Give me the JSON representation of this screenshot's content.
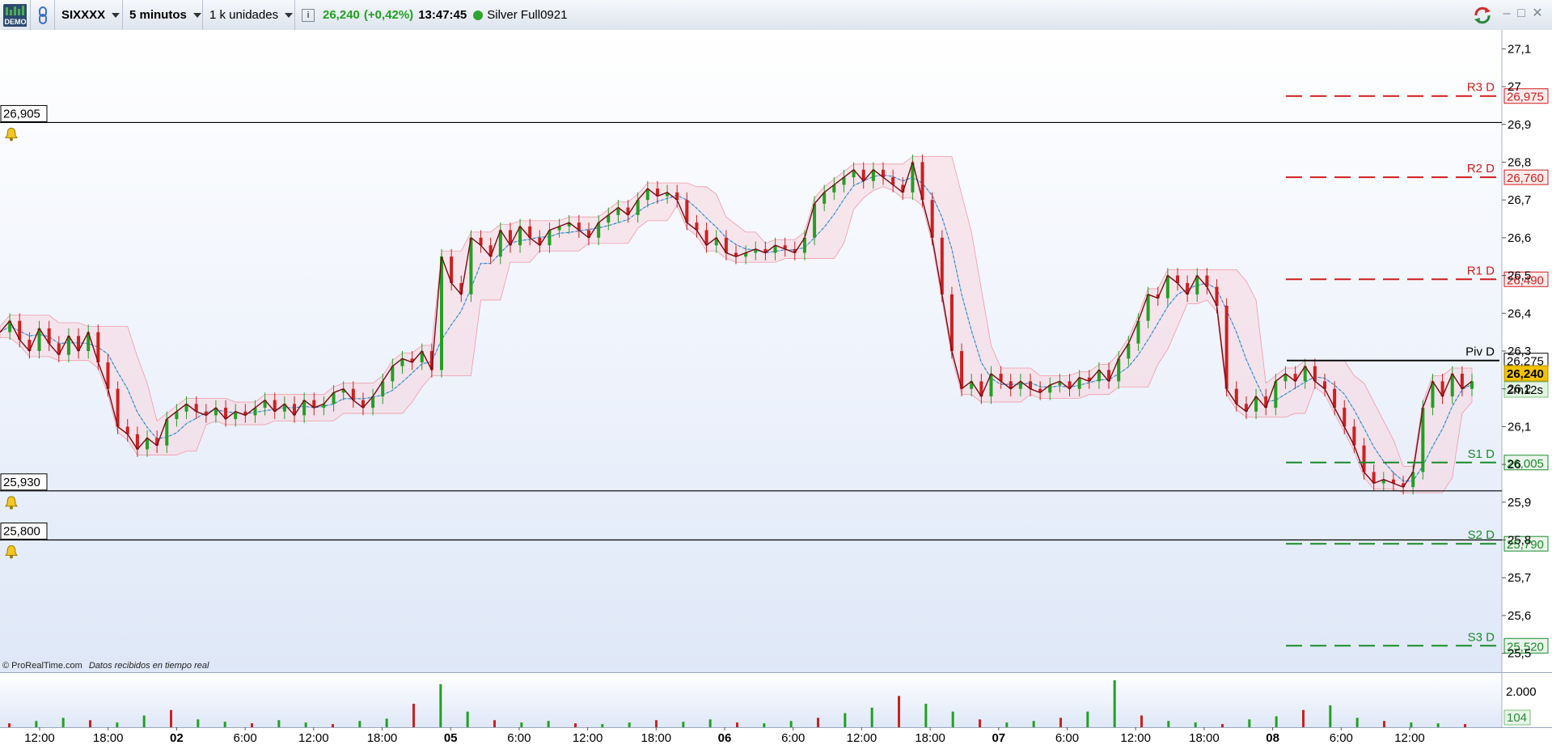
{
  "toolbar": {
    "demo_label": "DEMO",
    "instrument": "SIXXXX",
    "timeframe": "5 minutos",
    "units": "1 k unidades",
    "price": "26,240",
    "change": "(+0,42%)",
    "time": "13:47:45",
    "account": "Silver Full0921"
  },
  "colors": {
    "up": "#22a022",
    "down": "#cc2020",
    "status_dot": "#2ea52e",
    "pivot": "#000000",
    "resistance": "#d01c1c",
    "support": "#1a8a2a",
    "close_line": "#7a0a14",
    "current_price_bg": "#f2c200"
  },
  "copyright": "© ProRealTime.com",
  "copyright_note": "Datos recibidos en tiempo real",
  "chart_data": [
    {
      "type": "line",
      "series": [
        {
          "values": [
            26.35,
            26.38,
            26.33,
            26.3,
            26.36,
            26.32,
            26.29,
            26.34,
            26.3,
            26.35,
            26.27,
            26.2,
            26.1,
            26.08,
            26.04,
            26.07,
            26.05,
            26.12,
            26.14,
            26.16,
            26.14,
            26.13,
            26.15,
            26.12,
            26.14,
            26.13,
            26.15,
            26.17,
            26.14,
            26.16,
            26.13,
            26.17,
            26.15,
            26.16,
            26.19,
            26.2,
            26.17,
            26.15,
            26.18,
            26.22,
            26.26,
            26.28,
            26.27,
            26.3,
            26.25,
            26.55,
            26.48,
            26.45,
            26.6,
            26.58,
            26.55,
            26.62,
            26.58,
            26.63,
            26.6,
            26.58,
            26.62,
            26.63,
            26.64,
            26.62,
            26.6,
            26.64,
            26.66,
            26.68,
            26.66,
            26.7,
            26.73,
            26.71,
            26.72,
            26.7,
            26.64,
            26.62,
            26.58,
            26.6,
            26.56,
            26.55,
            26.56,
            26.57,
            26.56,
            26.58,
            26.57,
            26.56,
            26.6,
            26.69,
            26.72,
            26.74,
            26.76,
            26.78,
            26.75,
            26.78,
            26.76,
            26.74,
            26.72,
            26.8,
            26.7,
            26.6,
            26.45,
            26.3,
            26.2,
            26.22,
            26.18,
            26.24,
            26.22,
            26.2,
            26.22,
            26.2,
            26.19,
            26.21,
            26.22,
            26.2,
            26.23,
            26.22,
            26.25,
            26.22,
            26.28,
            26.32,
            26.38,
            26.45,
            26.44,
            26.5,
            26.48,
            26.45,
            26.5,
            26.47,
            26.42,
            26.2,
            26.16,
            26.14,
            26.18,
            26.15,
            26.22,
            26.24,
            26.22,
            26.26,
            26.22,
            26.2,
            26.15,
            26.1,
            26.05,
            25.98,
            25.95,
            25.96,
            25.95,
            25.94,
            25.98,
            26.15,
            26.22,
            26.18,
            26.24,
            26.2,
            26.22
          ]
        }
      ],
      "price_levels": {
        "R3": {
          "label": "R3 D",
          "value": "26,975"
        },
        "R2": {
          "label": "R2 D",
          "value": "26,760"
        },
        "R1": {
          "label": "R1 D",
          "value": "26,490"
        },
        "pivot": {
          "label": "Piv D",
          "value": "26,275"
        },
        "current": {
          "value": "26,240",
          "countdown": "2m12s"
        },
        "S1": {
          "label": "S1 D",
          "value": "26,005"
        },
        "S2": {
          "label": "S2 D",
          "value": "25,790"
        },
        "S3": {
          "label": "S3 D",
          "value": "25,520"
        }
      },
      "alerts": [
        "26,905",
        "25,930",
        "25,800"
      ],
      "yaxis_ticks": [
        "27,1",
        "27",
        "26,9",
        "26,8",
        "26,7",
        "26,6",
        "26,5",
        "26,4",
        "26,3",
        "26,2",
        "26,1",
        "26",
        "25,9",
        "25,8",
        "25,7",
        "25,6",
        "25,5"
      ],
      "ylim": [
        25.45,
        27.15
      ],
      "x_ticks": [
        {
          "label": "12:00",
          "bold": false
        },
        {
          "label": "18:00",
          "bold": false
        },
        {
          "label": "02",
          "bold": true
        },
        {
          "label": "6:00",
          "bold": false
        },
        {
          "label": "12:00",
          "bold": false
        },
        {
          "label": "18:00",
          "bold": false
        },
        {
          "label": "05",
          "bold": true
        },
        {
          "label": "6:00",
          "bold": false
        },
        {
          "label": "12:00",
          "bold": false
        },
        {
          "label": "18:00",
          "bold": false
        },
        {
          "label": "06",
          "bold": true
        },
        {
          "label": "6:00",
          "bold": false
        },
        {
          "label": "12:00",
          "bold": false
        },
        {
          "label": "18:00",
          "bold": false
        },
        {
          "label": "07",
          "bold": true
        },
        {
          "label": "6:00",
          "bold": false
        },
        {
          "label": "12:00",
          "bold": false
        },
        {
          "label": "18:00",
          "bold": false
        },
        {
          "label": "08",
          "bold": true
        },
        {
          "label": "6:00",
          "bold": false
        },
        {
          "label": "12:00",
          "bold": false
        }
      ]
    },
    {
      "type": "bar",
      "yaxis_ticks": [
        "2.000"
      ],
      "last_value": "104",
      "values": [
        5,
        8,
        12,
        9,
        6,
        15,
        22,
        10,
        7,
        5,
        9,
        6,
        4,
        8,
        11,
        30,
        55,
        20,
        9,
        6,
        8,
        5,
        4,
        6,
        9,
        7,
        10,
        6,
        5,
        8,
        12,
        18,
        25,
        40,
        30,
        20,
        10,
        6,
        8,
        12,
        20,
        60,
        15,
        8,
        6,
        4,
        10,
        14,
        22,
        28,
        12,
        8,
        6,
        5,
        4
      ]
    }
  ]
}
